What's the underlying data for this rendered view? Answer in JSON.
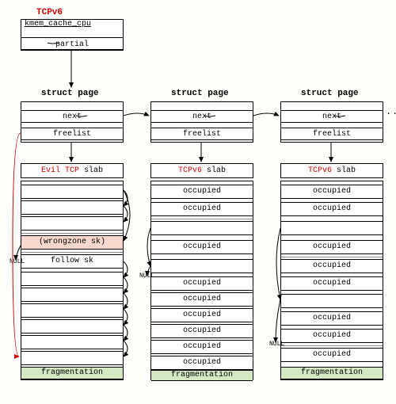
{
  "header": {
    "tcpv6": "TCPv6",
    "kmem": "kmem_cache_cpu",
    "partial": "partial"
  },
  "struct_page": {
    "label": "struct page",
    "next": "next",
    "freelist": "freelist"
  },
  "slabs": {
    "evil": {
      "prefix": "Evil TCP",
      "suffix": " slab"
    },
    "tcpv6": {
      "prefix": "TCPv6",
      "suffix": " slab"
    },
    "occupied": "occupied",
    "wrongzone": "(wrongzone sk)",
    "follow": "follow sk",
    "fragmentation": "fragmentation"
  },
  "null": "NULL",
  "dots": "......"
}
